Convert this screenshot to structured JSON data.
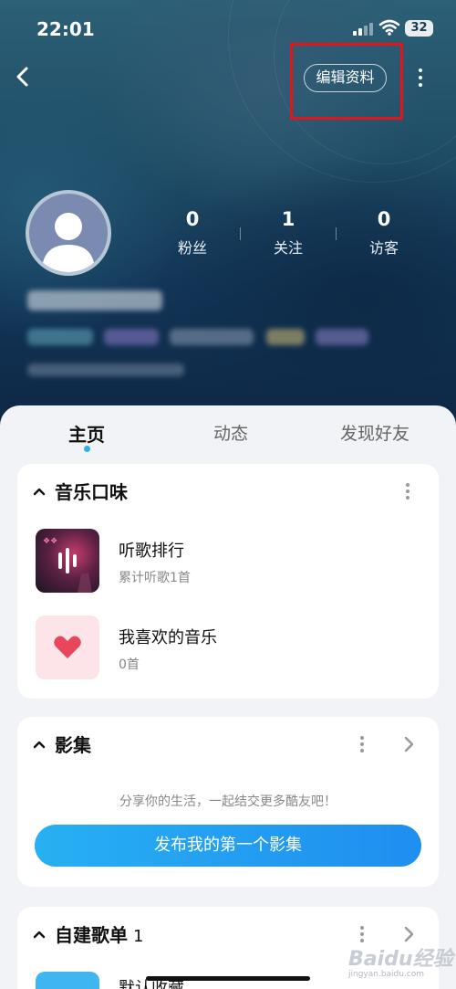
{
  "status_bar": {
    "time": "22:01",
    "battery": "32"
  },
  "header": {
    "edit_profile_label": "编辑资料",
    "stats": [
      {
        "value": "0",
        "label": "粉丝"
      },
      {
        "value": "1",
        "label": "关注"
      },
      {
        "value": "0",
        "label": "访客"
      }
    ]
  },
  "tabs": [
    {
      "label": "主页",
      "active": true
    },
    {
      "label": "动态",
      "active": false
    },
    {
      "label": "发现好友",
      "active": false
    }
  ],
  "music_taste": {
    "title": "音乐口味",
    "items": [
      {
        "title": "听歌排行",
        "subtitle": "累计听歌1首",
        "icon": "sound-bars-icon"
      },
      {
        "title": "我喜欢的音乐",
        "subtitle": "0首",
        "icon": "heart-icon"
      }
    ]
  },
  "album": {
    "title": "影集",
    "share_text": "分享你的生活，一起结交更多酷友吧！",
    "publish_label": "发布我的第一个影集"
  },
  "playlists": {
    "title": "自建歌单",
    "count": "1",
    "first_item": "默认收藏"
  },
  "watermark": {
    "text": "Baidu经验",
    "sub": "jingyan.baidu.com"
  },
  "colors": {
    "accent": "#2ab0ea",
    "button_gradient_start": "#27b0f2",
    "button_gradient_end": "#1f8ef0",
    "highlight": "#e3151b",
    "heart": "#e8465a"
  }
}
